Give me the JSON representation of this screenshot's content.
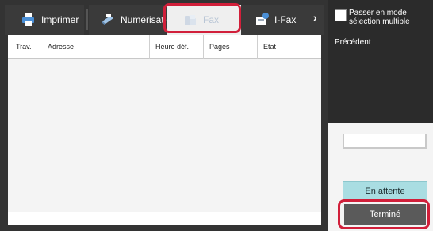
{
  "tabs": [
    {
      "label": "Imprimer",
      "icon": "printer-icon"
    },
    {
      "label": "Numérisation",
      "icon": "scanner-icon"
    },
    {
      "label": "Fax",
      "icon": "fax-icon"
    },
    {
      "label": "I-Fax",
      "icon": "internet-fax-icon"
    }
  ],
  "table": {
    "columns": [
      "Trav.",
      "Adresse",
      "Heure déf.",
      "Pages",
      "Etat"
    ]
  },
  "side_buttons": {
    "waiting_label": "En attente",
    "done_label": "Terminé"
  },
  "popup": {
    "multi_select_label": "Passer en mode sélection multiple",
    "previous_label": "Précédent"
  },
  "colors": {
    "highlight": "#d11f3a",
    "waiting_button": "#a9dde2",
    "done_button": "#5a5a5a",
    "tab_bar": "#333333"
  }
}
